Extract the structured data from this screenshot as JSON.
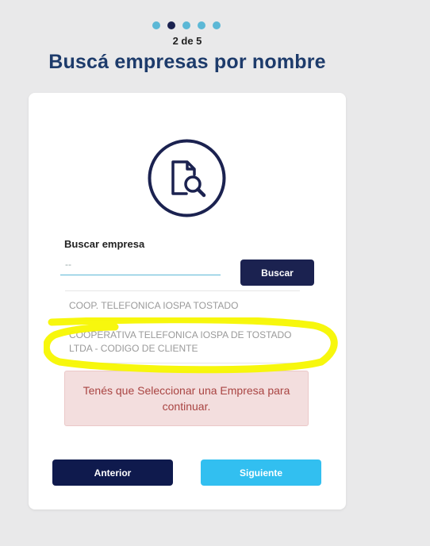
{
  "progress": {
    "total_steps": 5,
    "current_step": 2,
    "label": "2 de 5"
  },
  "page": {
    "title": "Buscá empresas por nombre"
  },
  "search": {
    "label": "Buscar empresa",
    "placeholder": "--",
    "button_label": "Buscar"
  },
  "results": [
    {
      "name": "COOP. TELEFONICA IOSPA TOSTADO"
    },
    {
      "name": "COOPERATIVA TELEFONICA IOSPA DE TOSTADO LTDA - CODIGO DE CLIENTE"
    }
  ],
  "error": {
    "message": "Tenés que Seleccionar una Empresa para continuar."
  },
  "navigation": {
    "prev_label": "Anterior",
    "next_label": "Siguiente"
  },
  "icons": {
    "header_icon": "document-search-icon"
  },
  "colors": {
    "title": "#1d3b6b",
    "dot_active": "#1b2250",
    "dot_inactive": "#5cb8d6",
    "primary_button": "#1b2250",
    "next_button": "#32bff0",
    "error_bg": "#f3dede",
    "error_text": "#a94442",
    "highlight": "#f7f700"
  }
}
